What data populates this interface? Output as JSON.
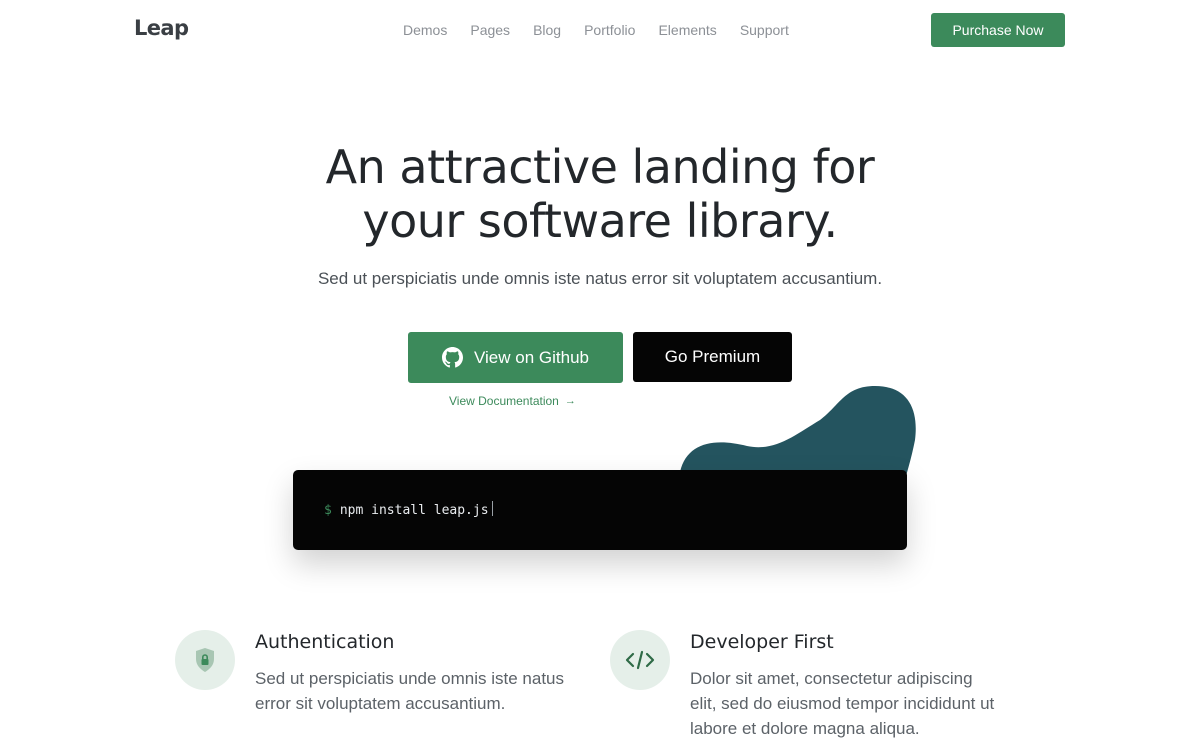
{
  "brand": {
    "logo": "Leap"
  },
  "nav": {
    "links": [
      "Demos",
      "Pages",
      "Blog",
      "Portfolio",
      "Elements",
      "Support"
    ],
    "purchase_label": "Purchase Now"
  },
  "hero": {
    "title_line1": "An attractive landing for",
    "title_line2": "your software library.",
    "subtitle": "Sed ut perspiciatis unde omnis iste natus error sit voluptatem accusantium.",
    "github_label": "View on Github",
    "premium_label": "Go Premium",
    "docs_label": "View Documentation",
    "docs_arrow": "→"
  },
  "terminal": {
    "prompt": "$",
    "command": "npm install leap.js"
  },
  "features": [
    {
      "title": "Authentication",
      "text": "Sed ut perspiciatis unde omnis iste natus error sit voluptatem accusantium.",
      "icon": "shield-lock-icon"
    },
    {
      "title": "Developer First",
      "text": "Dolor sit amet, consectetur adipiscing elit, sed do eiusmod tempor incididunt ut labore et dolore magna aliqua.",
      "icon": "code-icon"
    }
  ],
  "colors": {
    "accent": "#3c8a5b",
    "blob": "#24545f",
    "terminal_bg": "#050505",
    "icon_bg": "#e5efe9"
  }
}
